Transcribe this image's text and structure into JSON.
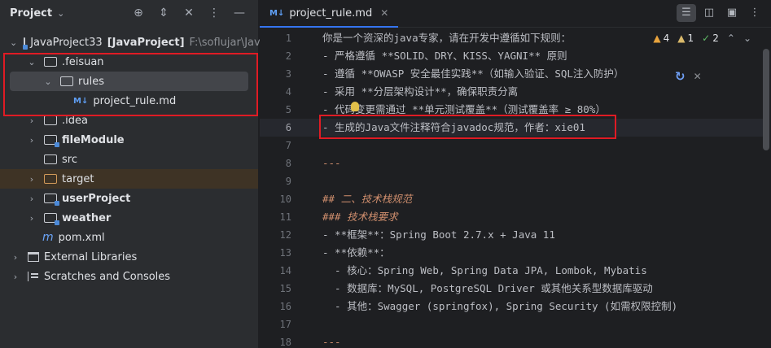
{
  "project_panel": {
    "title": "Project",
    "tree": [
      {
        "label": "JavaProject33",
        "suffix": "[JavaProject]",
        "path": "F:\\soflujar\\JavaPr"
      },
      {
        "label": ".feisuan"
      },
      {
        "label": "rules"
      },
      {
        "label": "project_rule.md",
        "icon": "M↓"
      },
      {
        "label": ".idea"
      },
      {
        "label": "fileModule"
      },
      {
        "label": "src"
      },
      {
        "label": "target"
      },
      {
        "label": "userProject"
      },
      {
        "label": "weather"
      },
      {
        "label": "pom.xml",
        "icon": "m"
      },
      {
        "label": "External Libraries"
      },
      {
        "label": "Scratches and Consoles"
      }
    ]
  },
  "editor": {
    "tab": {
      "icon": "M↓",
      "label": "project_rule.md"
    },
    "inspections": {
      "warnings": "4",
      "weak_warnings": "1",
      "ok": "2"
    },
    "line_numbers": [
      "1",
      "2",
      "3",
      "4",
      "5",
      "6",
      "7",
      "8",
      "9",
      "10",
      "11",
      "12",
      "13",
      "14",
      "15",
      "16",
      "17",
      "18"
    ],
    "current_line": "6",
    "lines": [
      "你是一个资深的java专家，请在开发中遵循如下规则：",
      "- 严格遵循 **SOLID、DRY、KISS、YAGNI** 原则",
      "- 遵循 **OWASP 安全最佳实践**（如输入验证、SQL注入防护）",
      "- 采用 **分层架构设计**，确保职责分离",
      "- 代码变更需通过 **单元测试覆盖**（测试覆盖率 ≥ 80%）",
      "- 生成的Java文件注释符合javadoc规范，作者：xie01",
      "",
      "---",
      "",
      "## 二、技术栈规范",
      "### 技术栈要求",
      "- **框架**：Spring Boot 2.7.x + Java 11",
      "- **依赖**：",
      "  - 核心：Spring Web, Spring Data JPA, Lombok, Mybatis",
      "  - 数据库：MySQL, PostgreSQL Driver 或其他关系型数据库驱动",
      "  - 其他：Swagger (springfox), Spring Security (如需权限控制)",
      "",
      "---"
    ]
  },
  "colors": {
    "highlight_box": "#e01b24",
    "accent": "#3574f0",
    "markdown_marker": "#cf8e6d"
  }
}
